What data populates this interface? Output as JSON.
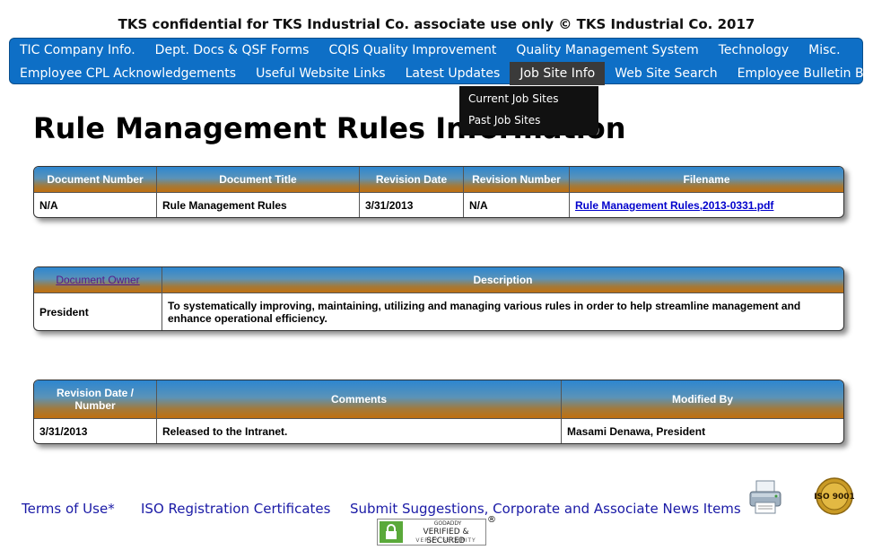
{
  "banner": "TKS confidential for TKS Industrial Co. associate use only © TKS Industrial Co. 2017",
  "nav": {
    "row1": [
      "TIC Company Info.",
      "Dept. Docs & QSF Forms",
      "CQIS Quality Improvement",
      "Quality Management System",
      "Technology",
      "Misc."
    ],
    "row2": [
      "Employee CPL Acknowledgements",
      "Useful Website Links",
      "Latest Updates",
      "Job Site Info",
      "Web Site Search",
      "Employee Bulletin Boards"
    ],
    "active": "Job Site Info",
    "dropdown": [
      "Current Job Sites",
      "Past Job Sites"
    ]
  },
  "page_title": "Rule Management Rules Information",
  "document_table": {
    "headers": [
      "Document Number",
      "Document Title",
      "Revision Date",
      "Revision Number",
      "Filename"
    ],
    "row": [
      "N/A",
      "Rule Management Rules",
      "3/31/2013",
      "N/A",
      "Rule Management Rules,2013-0331.pdf"
    ]
  },
  "owner_table": {
    "headers": [
      "Document Owner",
      "Description"
    ],
    "row": [
      "President",
      "To systematically improving, maintaining, utilizing and managing various rules in order to help streamline management and enhance operational efficiency."
    ]
  },
  "revision_table": {
    "headers": [
      "Revision Date / Number",
      "Comments",
      "Modified By"
    ],
    "row": [
      "3/31/2013",
      "Released to the Intranet.",
      "Masami Denawa, President"
    ]
  },
  "footer": {
    "links": [
      "Terms of Use*",
      "ISO Registration Certificates",
      "Submit Suggestions, Corporate and Associate News Items"
    ],
    "badge_top": "GODADDY",
    "badge_mid": "VERIFIED & SECURED",
    "badge_bot": "VERIFY SECURITY",
    "reg_mark": "®",
    "iso_text": "ISO 9001"
  },
  "colors": {
    "nav_bg": "#0e6fc6",
    "header_gradient_top": "#2d86d0",
    "header_gradient_bottom": "#c0700f",
    "link": "#0000cc"
  }
}
